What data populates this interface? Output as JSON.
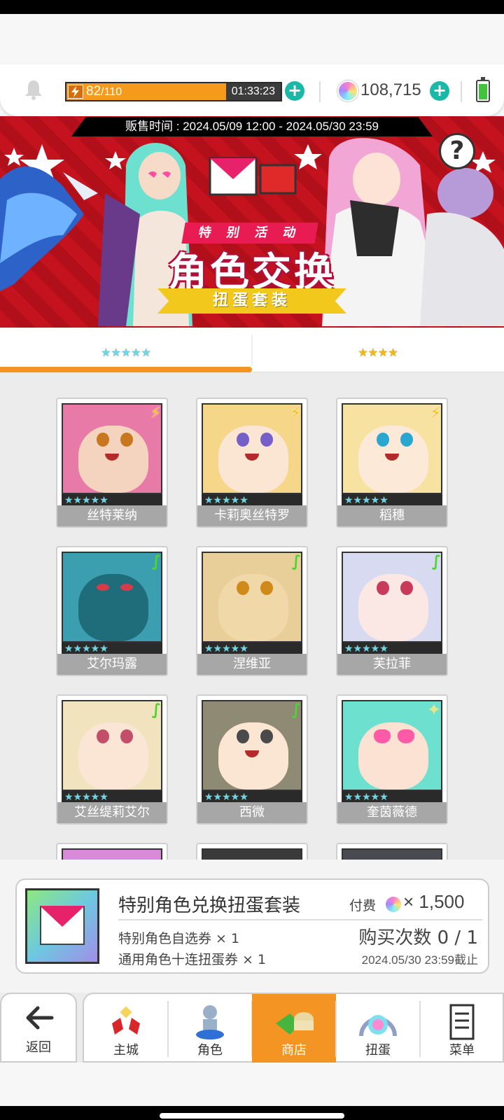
{
  "resources": {
    "energy_current": "82",
    "energy_max": "/110",
    "energy_fill_fraction": 0.745,
    "energy_timer": "01:33:23",
    "gems": "108,715"
  },
  "banner": {
    "sale_time": "贩售时间 : 2024.05/09 12:00 - 2024.05/30 23:59",
    "subtitle": "特 别 活 动",
    "title": "角色交换",
    "ribbon": "扭蛋套装",
    "help": "?"
  },
  "tabs": [
    {
      "stars": "★★★★★",
      "active": true
    },
    {
      "stars": "★★★★",
      "active": false
    }
  ],
  "cards": [
    {
      "name": "丝特莱纳",
      "stars": "★★★★★",
      "element": "bolt"
    },
    {
      "name": "卡莉奥丝特罗",
      "stars": "★★★★★",
      "element": "bolt"
    },
    {
      "name": "稻穗",
      "stars": "★★★★★",
      "element": "bolt"
    },
    {
      "name": "艾尔玛露",
      "stars": "★★★★★",
      "element": "leaf"
    },
    {
      "name": "涅维亚",
      "stars": "★★★★★",
      "element": "leaf"
    },
    {
      "name": "芙拉菲",
      "stars": "★★★★★",
      "element": "leaf"
    },
    {
      "name": "艾丝缇莉艾尔",
      "stars": "★★★★★",
      "element": "leaf"
    },
    {
      "name": "西微",
      "stars": "★★★★★",
      "element": "leaf"
    },
    {
      "name": "奎茵薇德",
      "stars": "★★★★★",
      "element": "spark"
    }
  ],
  "bundle": {
    "name": "特别角色兑换扭蛋套装",
    "item1": "特别角色自选券 × 1",
    "item2": "通用角色十连扭蛋券 × 1",
    "price_label": "付费",
    "price": "× 1,500",
    "buy_count": "购买次数 0 / 1",
    "deadline": "2024.05/30 23:59截止"
  },
  "nav": {
    "back": "返回",
    "items": [
      "主城",
      "角色",
      "商店",
      "扭蛋",
      "菜单"
    ],
    "active": "商店"
  },
  "colors": {
    "accent": "#f39423",
    "banner_red": "#c4131e",
    "plus_teal": "#19b9a8"
  }
}
